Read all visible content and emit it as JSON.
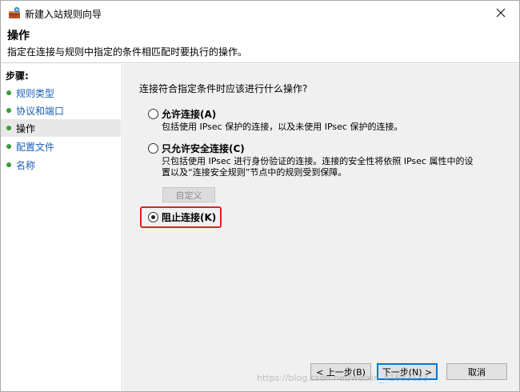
{
  "window": {
    "title": "新建入站规则向导"
  },
  "header": {
    "title": "操作",
    "subtitle": "指定在连接与规则中指定的条件相匹配时要执行的操作。"
  },
  "sidebar": {
    "steps_label": "步骤:",
    "items": [
      {
        "label": "规则类型",
        "active": false
      },
      {
        "label": "协议和端口",
        "active": false
      },
      {
        "label": "操作",
        "active": true
      },
      {
        "label": "配置文件",
        "active": false
      },
      {
        "label": "名称",
        "active": false
      }
    ]
  },
  "main": {
    "question": "连接符合指定条件时应该进行什么操作?",
    "options": [
      {
        "label": "允许连接(A)",
        "desc": "包括使用 IPsec 保护的连接，以及未使用 IPsec 保护的连接。",
        "checked": false
      },
      {
        "label": "只允许安全连接(C)",
        "desc_line1": "只包括使用 IPsec 进行身份验证的连接。连接的安全性将依照 IPsec 属性中的设",
        "desc_line2": "置以及“连接安全规则”节点中的规则受到保障。",
        "checked": false
      },
      {
        "label": "阻止连接(K)",
        "checked": true
      }
    ],
    "customize_label": "自定义"
  },
  "footer": {
    "back_label": "< 上一步(B)",
    "next_label": "下一步(N) >",
    "cancel_label": "取消"
  },
  "watermark": "https://blog.csdn.net/weixin_41683133",
  "colors": {
    "highlight": "#e0201e",
    "step_dot": "#3ca03c",
    "link": "#1a5fb4"
  }
}
